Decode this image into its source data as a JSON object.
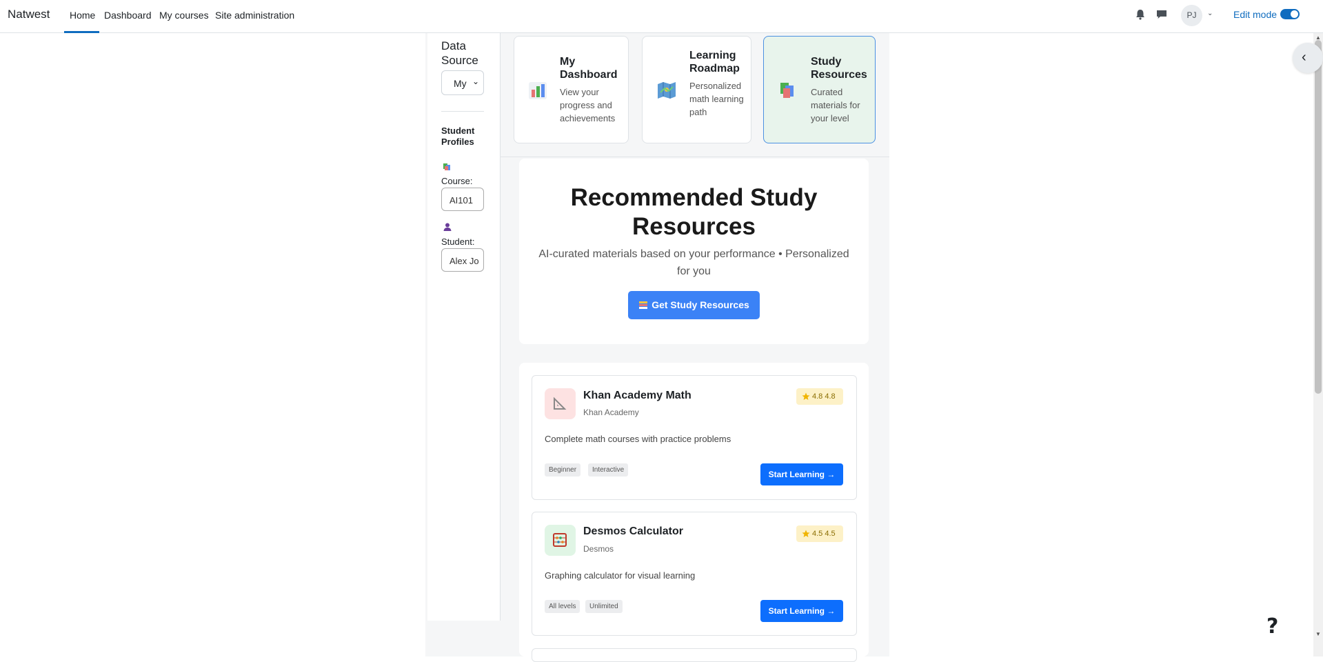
{
  "navbar": {
    "brand": "Natwest",
    "links": [
      "Home",
      "Dashboard",
      "My courses",
      "Site administration"
    ],
    "avatar_initials": "PJ",
    "edit_mode_label": "Edit mode",
    "edit_mode_on": true,
    "accent": "#0f6cbf"
  },
  "sidebar": {
    "data_source_title": "Data Source",
    "data_source_select": "My",
    "profiles_title": "Student Profiles",
    "course_label": "Course:",
    "course_value": "AI101",
    "student_label": "Student:",
    "student_value": "Alex Jo"
  },
  "feature_cards": [
    {
      "title": "My Dashboard",
      "desc": "View your progress and achievements",
      "icon": "bar-chart-icon"
    },
    {
      "title": "Learning Roadmap",
      "desc": "Personalized math learning path",
      "icon": "map-icon"
    },
    {
      "title": "Study Resources",
      "desc": "Curated materials for your level",
      "icon": "books-icon",
      "active": true
    }
  ],
  "hero": {
    "title": "Recommended Study Resources",
    "subtitle": "AI-curated materials based on your performance • Personalized for you",
    "button_label": "Get Study Resources",
    "button_color": "#3b82f6"
  },
  "resources": [
    {
      "name": "Khan Academy Math",
      "provider": "Khan Academy",
      "rating": "4.8 4.8",
      "description": "Complete math courses with practice problems",
      "tags": [
        "Beginner",
        "Interactive"
      ],
      "button_label": "Start Learning →",
      "icon": "triangle-ruler-icon"
    },
    {
      "name": "Desmos Calculator",
      "provider": "Desmos",
      "rating": "4.5 4.5",
      "description": "Graphing calculator for visual learning",
      "tags": [
        "All levels",
        "Unlimited"
      ],
      "button_label": "Start Learning →",
      "icon": "abacus-icon"
    }
  ],
  "help_label": "?"
}
